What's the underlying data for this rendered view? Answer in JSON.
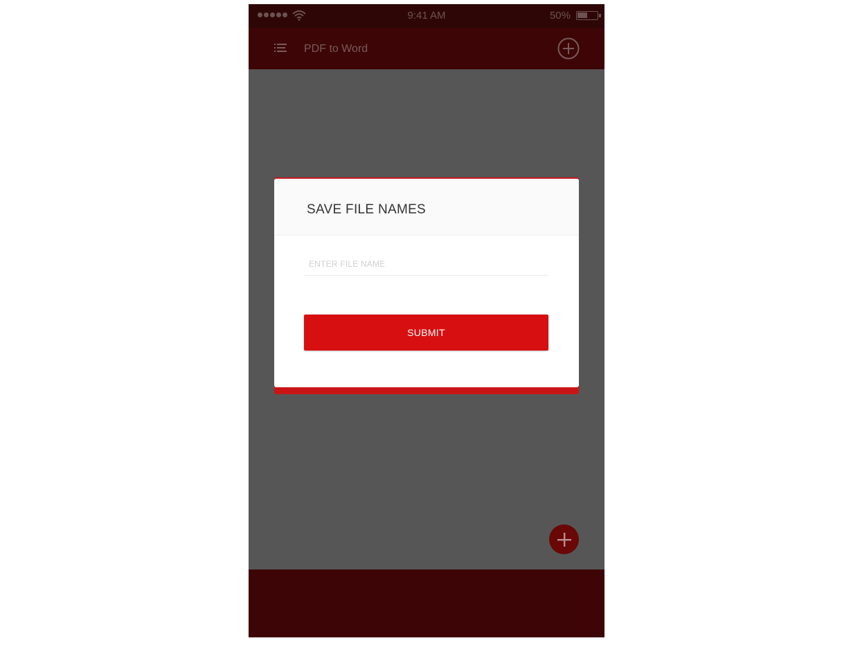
{
  "status_bar": {
    "time": "9:41 AM",
    "battery_percent": "50%",
    "battery_level": 0.5,
    "signal_icon": "signal-dots-icon",
    "wifi_icon": "wifi-icon"
  },
  "app_bar": {
    "title": "PDF to Word",
    "menu_icon": "menu-icon",
    "add_icon": "plus-circle-icon"
  },
  "dialog": {
    "title": "SAVE FILE NAMES",
    "input": {
      "placeholder": "ENTER FILE NAME",
      "value": ""
    },
    "submit_label": "SUBMIT"
  },
  "fab": {
    "icon": "plus-icon"
  },
  "colors": {
    "accent": "#d80f10",
    "app_bar": "#3d0505",
    "status_bar": "#2e0606",
    "overlay": "#565656"
  }
}
